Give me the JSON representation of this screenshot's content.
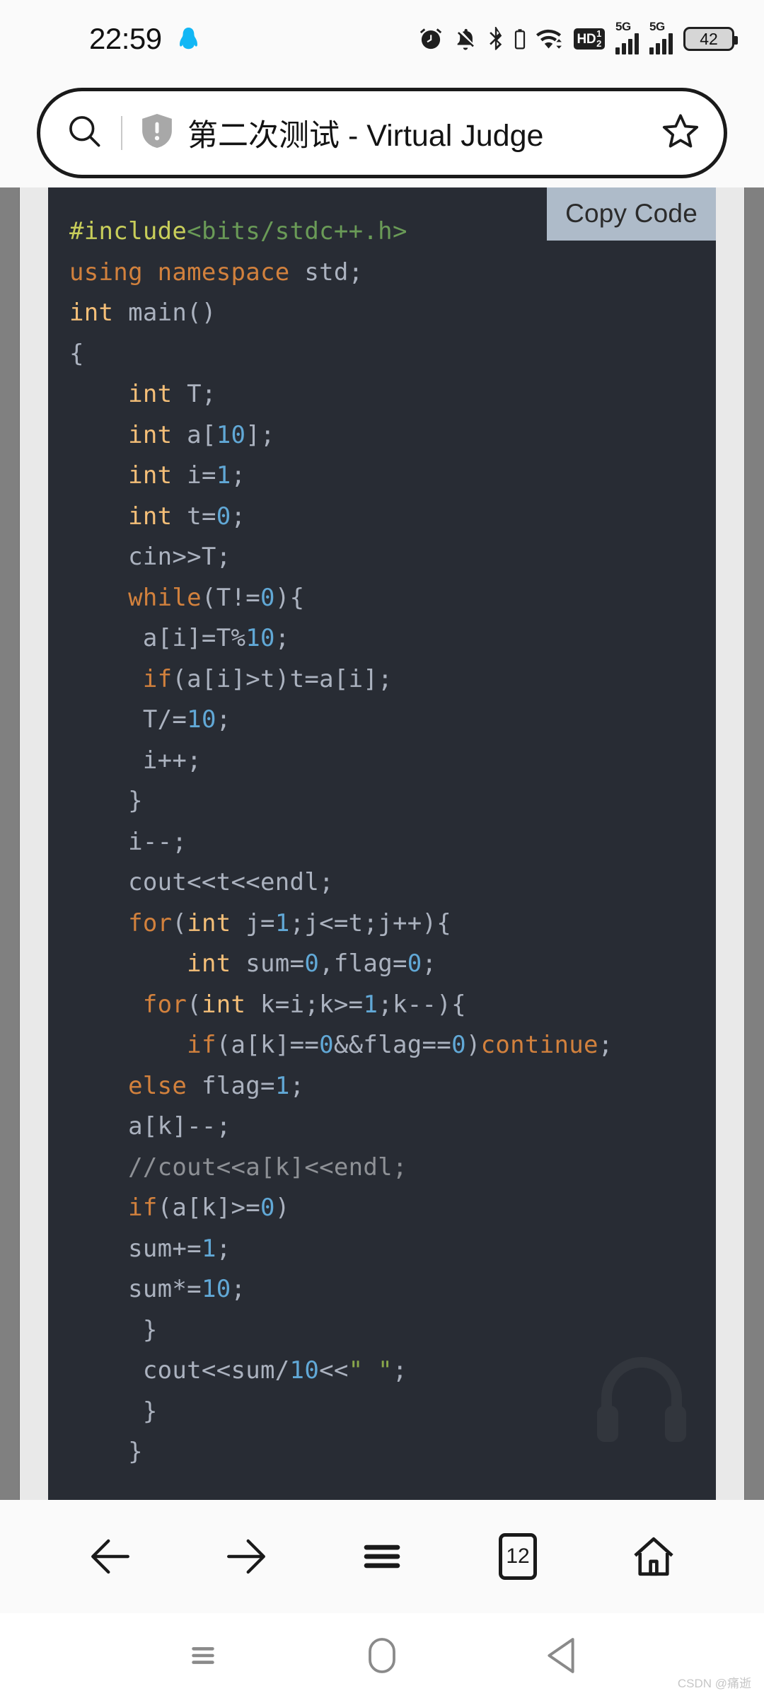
{
  "status_bar": {
    "time": "22:59",
    "icons_left": [
      "qq-icon"
    ],
    "icons_right": [
      "alarm-icon",
      "bell-muted-icon",
      "bluetooth-icon",
      "bluetooth-battery-icon",
      "wifi-icon",
      "volte-hd-icon",
      "signal-5g-sim1-icon",
      "signal-5g-sim2-icon",
      "battery-icon"
    ],
    "volte_label": "HD",
    "volte_sup": "1",
    "volte_sub": "2",
    "sim1_network": "5G",
    "sim2_network": "5G",
    "battery_percent": "42"
  },
  "url_bar": {
    "search_icon": "search-icon",
    "security_icon": "shield-warning-icon",
    "page_title": "第二次测试 - Virtual Judge",
    "bookmark_icon": "star-outline-icon"
  },
  "code_panel": {
    "copy_button_label": "Copy Code",
    "language": "cpp",
    "theme_background": "#282c34",
    "watermark_icon": "headphones-icon",
    "lines": [
      [
        {
          "t": "#include",
          "c": "tk-pre"
        },
        {
          "t": "<bits/stdc++.h>",
          "c": "tk-hdr"
        }
      ],
      [
        {
          "t": "using namespace",
          "c": "tk-kw"
        },
        {
          "t": " std;",
          "c": "tk-plain"
        }
      ],
      [
        {
          "t": "int",
          "c": "tk-type"
        },
        {
          "t": " main()",
          "c": "tk-plain"
        }
      ],
      [
        {
          "t": "{",
          "c": "tk-plain"
        }
      ],
      [
        {
          "t": "    ",
          "c": "tk-plain"
        },
        {
          "t": "int",
          "c": "tk-type"
        },
        {
          "t": " T;",
          "c": "tk-plain"
        }
      ],
      [
        {
          "t": "    ",
          "c": "tk-plain"
        },
        {
          "t": "int",
          "c": "tk-type"
        },
        {
          "t": " a[",
          "c": "tk-plain"
        },
        {
          "t": "10",
          "c": "tk-num"
        },
        {
          "t": "];",
          "c": "tk-plain"
        }
      ],
      [
        {
          "t": "    ",
          "c": "tk-plain"
        },
        {
          "t": "int",
          "c": "tk-type"
        },
        {
          "t": " i=",
          "c": "tk-plain"
        },
        {
          "t": "1",
          "c": "tk-num"
        },
        {
          "t": ";",
          "c": "tk-plain"
        }
      ],
      [
        {
          "t": "    ",
          "c": "tk-plain"
        },
        {
          "t": "int",
          "c": "tk-type"
        },
        {
          "t": " t=",
          "c": "tk-plain"
        },
        {
          "t": "0",
          "c": "tk-num"
        },
        {
          "t": ";",
          "c": "tk-plain"
        }
      ],
      [
        {
          "t": "    cin>>T;",
          "c": "tk-plain"
        }
      ],
      [
        {
          "t": "    ",
          "c": "tk-plain"
        },
        {
          "t": "while",
          "c": "tk-kw"
        },
        {
          "t": "(T!=",
          "c": "tk-plain"
        },
        {
          "t": "0",
          "c": "tk-num"
        },
        {
          "t": "){",
          "c": "tk-plain"
        }
      ],
      [
        {
          "t": "     a[i]=T%",
          "c": "tk-plain"
        },
        {
          "t": "10",
          "c": "tk-num"
        },
        {
          "t": ";",
          "c": "tk-plain"
        }
      ],
      [
        {
          "t": "     ",
          "c": "tk-plain"
        },
        {
          "t": "if",
          "c": "tk-kw"
        },
        {
          "t": "(a[i]>t)t=a[i];",
          "c": "tk-plain"
        }
      ],
      [
        {
          "t": "     T/=",
          "c": "tk-plain"
        },
        {
          "t": "10",
          "c": "tk-num"
        },
        {
          "t": ";",
          "c": "tk-plain"
        }
      ],
      [
        {
          "t": "     i++;",
          "c": "tk-plain"
        }
      ],
      [
        {
          "t": "    }",
          "c": "tk-plain"
        }
      ],
      [
        {
          "t": "    i--;",
          "c": "tk-plain"
        }
      ],
      [
        {
          "t": "    cout<<t<<endl;",
          "c": "tk-plain"
        }
      ],
      [
        {
          "t": "    ",
          "c": "tk-plain"
        },
        {
          "t": "for",
          "c": "tk-kw"
        },
        {
          "t": "(",
          "c": "tk-plain"
        },
        {
          "t": "int",
          "c": "tk-type"
        },
        {
          "t": " j=",
          "c": "tk-plain"
        },
        {
          "t": "1",
          "c": "tk-num"
        },
        {
          "t": ";j<=t;j++){",
          "c": "tk-plain"
        }
      ],
      [
        {
          "t": "        ",
          "c": "tk-plain"
        },
        {
          "t": "int",
          "c": "tk-type"
        },
        {
          "t": " sum=",
          "c": "tk-plain"
        },
        {
          "t": "0",
          "c": "tk-num"
        },
        {
          "t": ",flag=",
          "c": "tk-plain"
        },
        {
          "t": "0",
          "c": "tk-num"
        },
        {
          "t": ";",
          "c": "tk-plain"
        }
      ],
      [
        {
          "t": "     ",
          "c": "tk-plain"
        },
        {
          "t": "for",
          "c": "tk-kw"
        },
        {
          "t": "(",
          "c": "tk-plain"
        },
        {
          "t": "int",
          "c": "tk-type"
        },
        {
          "t": " k=i;k>=",
          "c": "tk-plain"
        },
        {
          "t": "1",
          "c": "tk-num"
        },
        {
          "t": ";k--){",
          "c": "tk-plain"
        }
      ],
      [
        {
          "t": "        ",
          "c": "tk-plain"
        },
        {
          "t": "if",
          "c": "tk-kw"
        },
        {
          "t": "(a[k]==",
          "c": "tk-plain"
        },
        {
          "t": "0",
          "c": "tk-num"
        },
        {
          "t": "&&flag==",
          "c": "tk-plain"
        },
        {
          "t": "0",
          "c": "tk-num"
        },
        {
          "t": ")",
          "c": "tk-plain"
        },
        {
          "t": "continue",
          "c": "tk-kw"
        },
        {
          "t": ";",
          "c": "tk-plain"
        }
      ],
      [
        {
          "t": "    ",
          "c": "tk-plain"
        },
        {
          "t": "else",
          "c": "tk-kw"
        },
        {
          "t": " flag=",
          "c": "tk-plain"
        },
        {
          "t": "1",
          "c": "tk-num"
        },
        {
          "t": ";",
          "c": "tk-plain"
        }
      ],
      [
        {
          "t": "    a[k]--;",
          "c": "tk-plain"
        }
      ],
      [
        {
          "t": "    ",
          "c": "tk-plain"
        },
        {
          "t": "//cout<<a[k]<<endl;",
          "c": "tk-cmt"
        }
      ],
      [
        {
          "t": "    ",
          "c": "tk-plain"
        },
        {
          "t": "if",
          "c": "tk-kw"
        },
        {
          "t": "(a[k]>=",
          "c": "tk-plain"
        },
        {
          "t": "0",
          "c": "tk-num"
        },
        {
          "t": ")",
          "c": "tk-plain"
        }
      ],
      [
        {
          "t": "    sum+=",
          "c": "tk-plain"
        },
        {
          "t": "1",
          "c": "tk-num"
        },
        {
          "t": ";",
          "c": "tk-plain"
        }
      ],
      [
        {
          "t": "    sum*=",
          "c": "tk-plain"
        },
        {
          "t": "10",
          "c": "tk-num"
        },
        {
          "t": ";",
          "c": "tk-plain"
        }
      ],
      [
        {
          "t": "     }",
          "c": "tk-plain"
        }
      ],
      [
        {
          "t": "     cout<<sum/",
          "c": "tk-plain"
        },
        {
          "t": "10",
          "c": "tk-num"
        },
        {
          "t": "<<",
          "c": "tk-plain"
        },
        {
          "t": "\" \"",
          "c": "tk-str"
        },
        {
          "t": ";",
          "c": "tk-plain"
        }
      ],
      [
        {
          "t": "     }",
          "c": "tk-plain"
        }
      ],
      [
        {
          "t": "    }",
          "c": "tk-plain"
        }
      ]
    ]
  },
  "browser_nav": {
    "items": [
      {
        "name": "back-icon",
        "label": "Back"
      },
      {
        "name": "forward-icon",
        "label": "Forward"
      },
      {
        "name": "menu-icon",
        "label": "Menu"
      },
      {
        "name": "tabs-icon",
        "label": "Tabs"
      },
      {
        "name": "home-icon",
        "label": "Home"
      }
    ],
    "tab_count": "12"
  },
  "system_nav": {
    "items": [
      {
        "name": "recents-icon",
        "label": "Recents"
      },
      {
        "name": "home-pill-icon",
        "label": "Home"
      },
      {
        "name": "back-triangle-icon",
        "label": "Back"
      }
    ]
  },
  "watermark": {
    "text": "CSDN @痛逝"
  }
}
